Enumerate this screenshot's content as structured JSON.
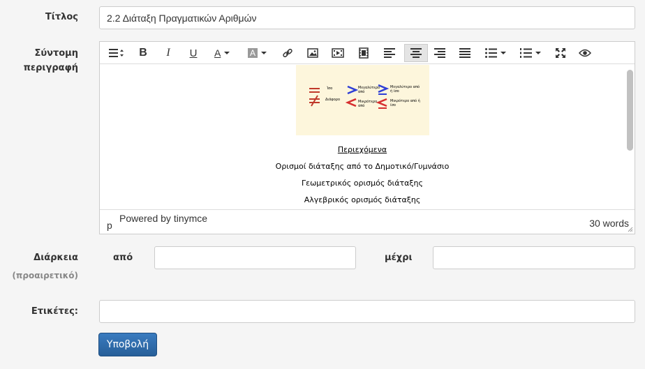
{
  "form": {
    "title_label": "Τίτλος",
    "title_value": "2.2 Διάταξη Πραγματικών Αριθμών",
    "description_label_1": "Σύντομη",
    "description_label_2": "περιγραφή",
    "duration_label": "Διάρκεια",
    "duration_optional": "(προαιρετικό)",
    "from_label": "από",
    "to_label": "μέχρι",
    "from_value": "",
    "to_value": "",
    "tags_label": "Ετικέτες:",
    "tags_value": "",
    "submit_label": "Υποβολή"
  },
  "editor": {
    "toolbar": [
      "formats-icon",
      "bold-icon",
      "italic-icon",
      "underline-icon",
      "text-color-icon",
      "background-color-icon",
      "link-icon",
      "image-icon",
      "media-icon",
      "video-icon",
      "align-left-icon",
      "align-center-icon",
      "align-right-icon",
      "justify-icon",
      "bullet-list-icon",
      "numbered-list-icon",
      "fullscreen-icon",
      "preview-icon"
    ],
    "figure": {
      "equal": "Ίσο",
      "not_equal": "Διάφορο",
      "greater": "Μεγαλύτερο από",
      "greater_eq": "Μεγαλύτερο από ή ίσο",
      "less": "Μικρότερο από",
      "less_eq": "Μικρότερο από ή ίσο"
    },
    "lines": [
      "Περιεχόμενα",
      "Ορισμοί διάταξης από το Δημοτικό/Γυμνάσιο",
      "Γεωμετρικός ορισμός διάταξης",
      "Αλγεβρικός ορισμός διάταξης"
    ],
    "status_path": "p",
    "powered_by": "Powered by tinymce",
    "word_count": "30 words"
  }
}
